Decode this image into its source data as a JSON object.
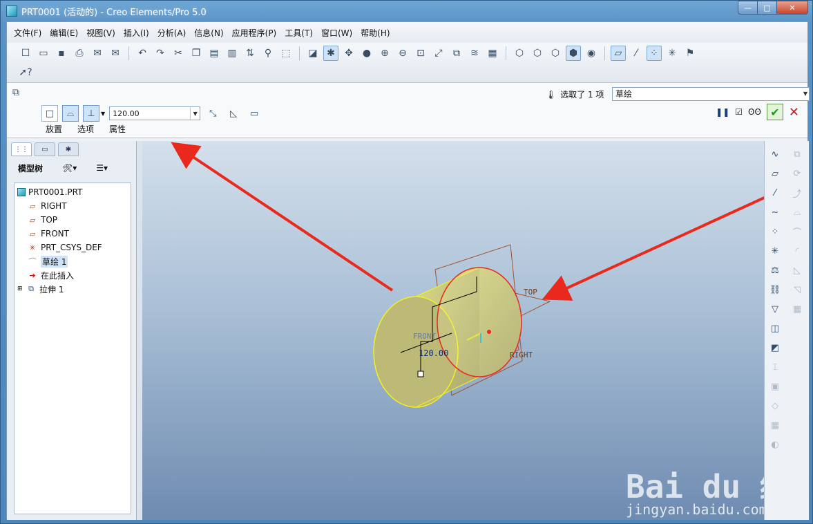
{
  "window": {
    "title": "PRT0001 (活动的) - Creo Elements/Pro 5.0",
    "minimize_label": "—",
    "maximize_label": "□",
    "close_label": "✕"
  },
  "menu": [
    "文件(F)",
    "编辑(E)",
    "视图(V)",
    "插入(I)",
    "分析(A)",
    "信息(N)",
    "应用程序(P)",
    "工具(T)",
    "窗口(W)",
    "帮助(H)"
  ],
  "dashboard": {
    "depth_value": "120.00",
    "tabs": [
      "放置",
      "选项",
      "属性"
    ],
    "selection_text": "选取了 1 项",
    "filter_value": "草绘"
  },
  "model_tree": {
    "title": "模型树",
    "items": [
      {
        "label": "PRT0001.PRT",
        "icon": "part-icon"
      },
      {
        "label": "RIGHT",
        "icon": "datum-plane-icon"
      },
      {
        "label": "TOP",
        "icon": "datum-plane-icon"
      },
      {
        "label": "FRONT",
        "icon": "datum-plane-icon"
      },
      {
        "label": "PRT_CSYS_DEF",
        "icon": "csys-icon"
      },
      {
        "label": "草绘 1",
        "icon": "sketch-icon"
      },
      {
        "label": "在此插入",
        "icon": "insert-here-icon"
      },
      {
        "label": "拉伸 1",
        "icon": "extrude-icon"
      }
    ]
  },
  "viewport": {
    "plane_labels": {
      "top": "TOP",
      "right": "RIGHT",
      "front": "FRONT"
    },
    "dimension_value": "120.00"
  },
  "colors": {
    "arrow": "#e8291c",
    "cylinder_edge": "#f2f21c",
    "sketch_circle": "#e8291c",
    "datum_plane": "#a0522d",
    "ok_green": "#1f9a1f",
    "cancel_red": "#d01818"
  },
  "watermark": {
    "brand": "Bai du 经验",
    "url": "jingyan.baidu.com"
  }
}
